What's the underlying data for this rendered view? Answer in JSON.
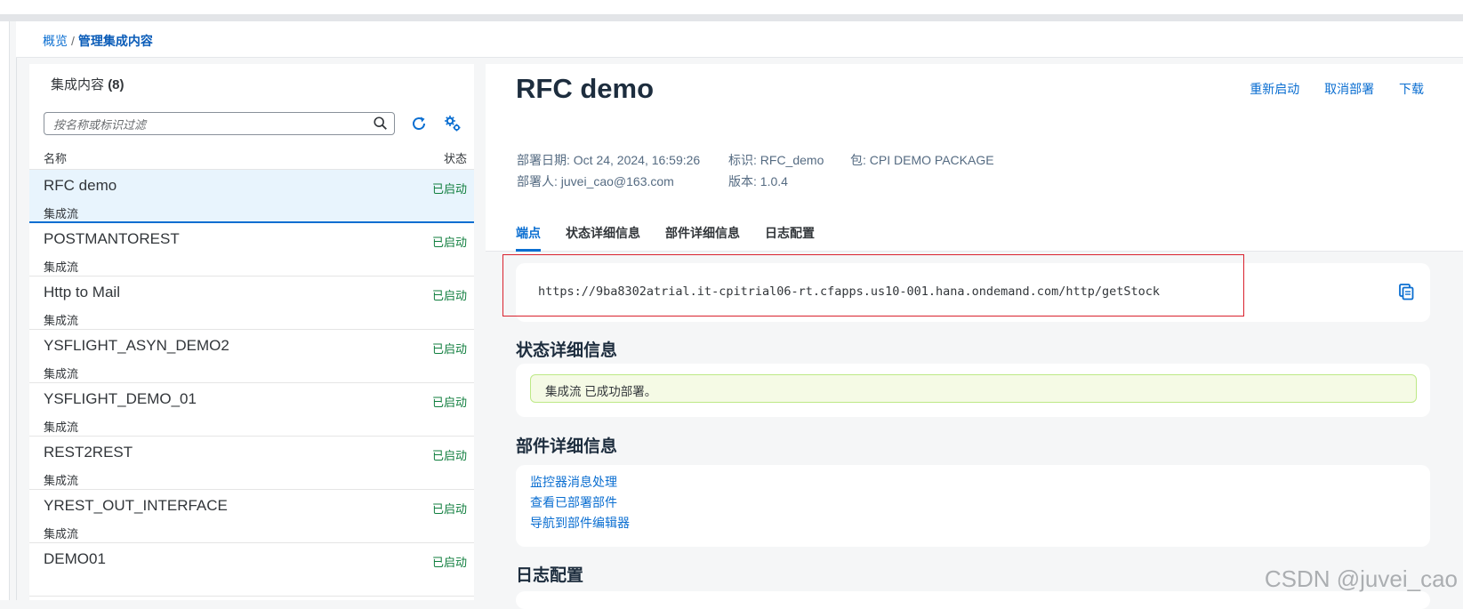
{
  "breadcrumb": {
    "home": "概览",
    "separator": "/",
    "current": "管理集成内容"
  },
  "list": {
    "title": "集成内容",
    "count": "(8)",
    "search_placeholder": "按名称或标识过滤",
    "col_name": "名称",
    "col_status": "状态",
    "items": [
      {
        "title": "RFC demo",
        "type": "集成流",
        "status": "已启动",
        "selected": true
      },
      {
        "title": "POSTMANTOREST",
        "type": "集成流",
        "status": "已启动"
      },
      {
        "title": "Http to Mail",
        "type": "集成流",
        "status": "已启动"
      },
      {
        "title": "YSFLIGHT_ASYN_DEMO2",
        "type": "集成流",
        "status": "已启动"
      },
      {
        "title": "YSFLIGHT_DEMO_01",
        "type": "集成流",
        "status": "已启动"
      },
      {
        "title": "REST2REST",
        "type": "集成流",
        "status": "已启动"
      },
      {
        "title": "YREST_OUT_INTERFACE",
        "type": "集成流",
        "status": "已启动"
      },
      {
        "title": "DEMO01",
        "type": "",
        "status": "已启动"
      }
    ]
  },
  "detail": {
    "title": "RFC demo",
    "actions": {
      "restart": "重新启动",
      "undeploy": "取消部署",
      "download": "下载"
    },
    "meta": {
      "deploy_date": "部署日期: Oct 24, 2024, 16:59:26",
      "deployed_by": "部署人: juvei_cao@163.com",
      "id": "标识: RFC_demo",
      "version": "版本: 1.0.4",
      "package": "包: CPI DEMO PACKAGE"
    },
    "tabs": [
      "端点",
      "状态详细信息",
      "部件详细信息",
      "日志配置"
    ],
    "endpoint_url": "https://9ba8302atrial.it-cpitrial06-rt.cfapps.us10-001.hana.ondemand.com/http/getStock",
    "status_section_title": "状态详细信息",
    "status_message": "集成流 已成功部署。",
    "artifact_section_title": "部件详细信息",
    "artifact_links": [
      "监控器消息处理",
      "查看已部署部件",
      "导航到部件编辑器"
    ],
    "log_section_title": "日志配置"
  },
  "watermark": "CSDN @juvei_cao",
  "colors": {
    "accent": "#0a6ed1",
    "status_ok": "#107e3e",
    "highlight": "#d9212d"
  },
  "icons": [
    "search-icon",
    "refresh-icon",
    "settings-icon",
    "copy-icon"
  ]
}
